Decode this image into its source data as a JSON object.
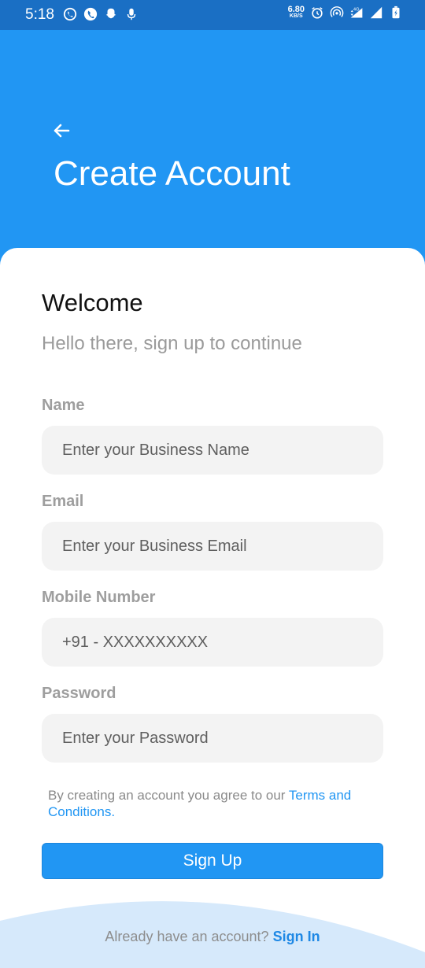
{
  "status_bar": {
    "time": "5:18",
    "speed_value": "6.80",
    "speed_unit": "KB/S",
    "network": "4G"
  },
  "header": {
    "title": "Create Account",
    "background_color": "#2196f3"
  },
  "intro": {
    "welcome": "Welcome",
    "subtitle": "Hello there, sign up to continue"
  },
  "form": {
    "name": {
      "label": "Name",
      "placeholder": "Enter your Business Name"
    },
    "email": {
      "label": "Email",
      "placeholder": "Enter your Business Email"
    },
    "mobile": {
      "label": "Mobile Number",
      "placeholder": "+91 - XXXXXXXXXX"
    },
    "password": {
      "label": "Password",
      "placeholder": "Enter your Password"
    }
  },
  "terms": {
    "prefix": "By creating an account you agree to our ",
    "link": "Terms and Conditions."
  },
  "signup_button": {
    "label": "Sign Up"
  },
  "footer": {
    "prompt": "Already have an account? ",
    "link": "Sign In"
  }
}
